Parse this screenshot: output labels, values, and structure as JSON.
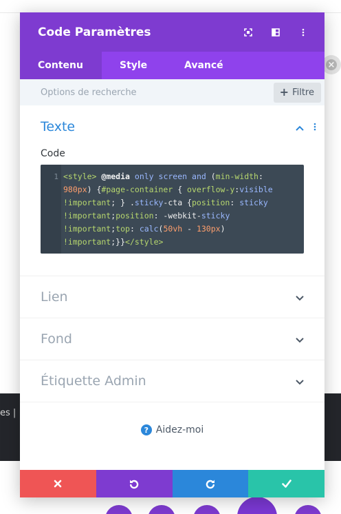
{
  "colors": {
    "purple": "#7e3bd0",
    "purple_light": "#8f42ec",
    "blue": "#2b87da",
    "red": "#ef5555",
    "green": "#29c4a9",
    "code_bg": "#3c4955"
  },
  "background": {
    "dark_strip_text": "es |"
  },
  "modal": {
    "title": "Code Paramètres",
    "header_icons": [
      "focus-icon",
      "split-view-icon",
      "more-vertical-icon"
    ]
  },
  "tabs": [
    {
      "label": "Contenu",
      "active": true
    },
    {
      "label": "Style",
      "active": false
    },
    {
      "label": "Avancé",
      "active": false
    }
  ],
  "search": {
    "placeholder": "Options de recherche",
    "filter_label": "Filtre"
  },
  "sections": {
    "open": {
      "title": "Texte",
      "field_label": "Code",
      "line_number": "1"
    },
    "collapsed": [
      {
        "title": "Lien"
      },
      {
        "title": "Fond"
      },
      {
        "title": "Étiquette Admin"
      }
    ]
  },
  "code": {
    "lines": [
      "<style> @media only screen and (min-width:",
      "980px) {#page-container { overflow-y:visible",
      "!important; } .sticky-cta {position: sticky",
      "!important;position: -webkit-sticky",
      "!important;top: calc(50vh - 130px)",
      "!important;}}</style>"
    ]
  },
  "help": {
    "icon": "?",
    "label": "Aidez-moi"
  },
  "footer": {
    "buttons": [
      {
        "name": "cancel",
        "icon": "close-icon",
        "color": "#ef5555"
      },
      {
        "name": "undo",
        "icon": "undo-icon",
        "color": "#7e3bd0"
      },
      {
        "name": "redo",
        "icon": "redo-icon",
        "color": "#2b87da"
      },
      {
        "name": "save",
        "icon": "check-icon",
        "color": "#29c4a9"
      }
    ]
  }
}
